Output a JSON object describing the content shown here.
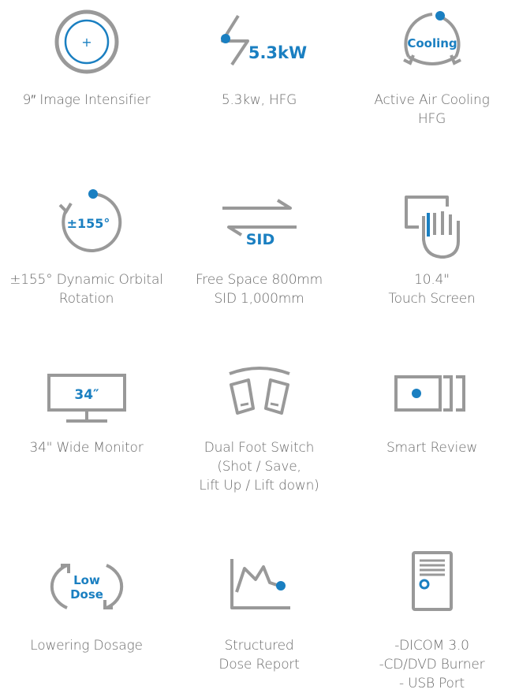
{
  "colors": {
    "gray": "#999999",
    "blue": "#1a7fc1",
    "text": "#6a6a6a"
  },
  "features": [
    {
      "icon": "image-intensifier-icon",
      "icon_text": "+",
      "label": [
        "9″ Image Intensifier"
      ]
    },
    {
      "icon": "power-bolt-icon",
      "icon_text": "5.3kW",
      "label": [
        "5.3kw, HFG"
      ]
    },
    {
      "icon": "cooling-icon",
      "icon_text": "Cooling",
      "label": [
        "Active Air Cooling",
        "HFG"
      ]
    },
    {
      "icon": "orbital-rotation-icon",
      "icon_text": "±155°",
      "label": [
        "±155° Dynamic Orbital",
        "Rotation"
      ]
    },
    {
      "icon": "sid-arrows-icon",
      "icon_text": "SID",
      "label": [
        "Free Space 800mm",
        "SID 1,000mm"
      ]
    },
    {
      "icon": "touch-screen-icon",
      "icon_text": "",
      "label": [
        "10.4\"",
        "Touch Screen"
      ]
    },
    {
      "icon": "monitor-icon",
      "icon_text": "34″",
      "label": [
        "34\" Wide Monitor"
      ]
    },
    {
      "icon": "foot-switch-icon",
      "icon_text": "",
      "label": [
        "Dual Foot Switch",
        "(Shot / Save,",
        "Lift Up / Lift down)"
      ]
    },
    {
      "icon": "smart-review-icon",
      "icon_text": "",
      "label": [
        "Smart Review"
      ]
    },
    {
      "icon": "low-dose-icon",
      "icon_text_1": "Low",
      "icon_text_2": "Dose",
      "label": [
        "Lowering Dosage"
      ]
    },
    {
      "icon": "dose-report-icon",
      "icon_text": "",
      "label": [
        "Structured",
        "Dose Report"
      ]
    },
    {
      "icon": "pc-tower-icon",
      "icon_text": "",
      "label": [
        "-DICOM 3.0",
        "-CD/DVD Burner",
        "- USB Port"
      ]
    }
  ]
}
